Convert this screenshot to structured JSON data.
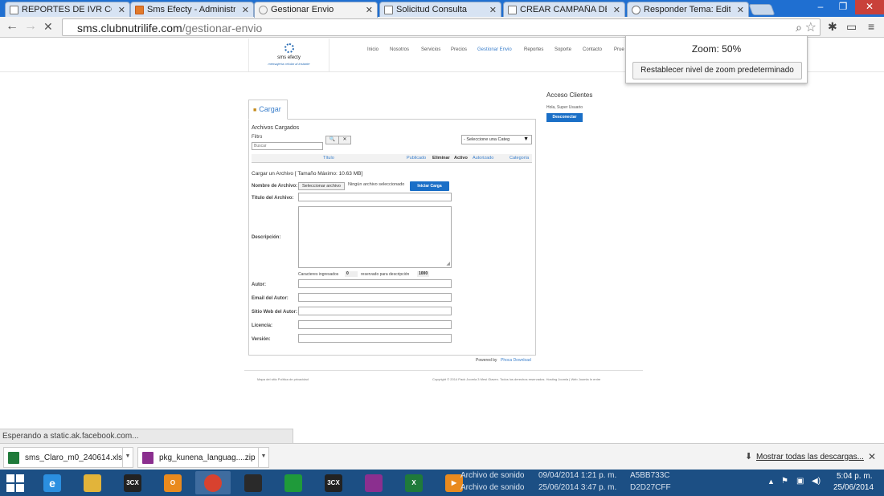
{
  "browser": {
    "tabs": [
      {
        "title": "REPORTES DE IVR CON M..."
      },
      {
        "title": "Sms Efecty - Administraci..."
      },
      {
        "title": "Gestionar Envio"
      },
      {
        "title": "Solicitud Consulta"
      },
      {
        "title": "CREAR CAMPAÑA DE IVR..."
      },
      {
        "title": "Responder Tema: Editar F..."
      }
    ],
    "url_host": "sms.clubnutrilife.com",
    "url_path": "/gestionar-envio",
    "zoom_popup": {
      "title": "Zoom: 50%",
      "reset_label": "Restablecer nivel de zoom predeterminado"
    }
  },
  "site": {
    "logo_name": "sms efecty",
    "logo_tagline": "mensajería celular al instante",
    "nav": [
      "Inicio",
      "Nosotros",
      "Servicios",
      "Precios",
      "Gestionar Envio",
      "Reportes",
      "Soporte",
      "Contacto",
      "Prue"
    ],
    "active_nav": "Gestionar Envio",
    "upload": {
      "tab_label": "Cargar",
      "section_title": "Archivos Cargados",
      "filter_label": "Filtro",
      "filter_placeholder": "Buscar",
      "search_btn": "🔍",
      "clear_btn": "✕",
      "category_select": "- Seleccione una Categ",
      "columns": [
        "Título",
        "Publicado",
        "Eliminar",
        "Activo",
        "Autorizado",
        "Categoría"
      ],
      "upload_title": "Cargar un Archivo [ Tamaño Máximo: 10.63 MB]",
      "file_label": "Nombre de Archivo:",
      "select_file_btn": "Seleccionar archivo",
      "no_file_text": "Ningún archivo seleccionado",
      "start_upload_btn": "Iniciar Carga",
      "title_label": "Título del Archivo:",
      "desc_label": "Descripción:",
      "chars_label": "Caracteres ingresados",
      "chars_value": "0",
      "reserved_label": "reservado para descripción",
      "reserved_value": "1000",
      "author_label": "Autor:",
      "email_label": "Email del Autor:",
      "website_label": "Sitio Web del Autor:",
      "license_label": "Licencia:",
      "version_label": "Versión:",
      "powered_by": "Powered by",
      "powered_link": "Phoca Download"
    },
    "sidebar": {
      "title": "Acceso Clientes",
      "greeting": "Hola, Super Usuario",
      "logout_btn": "Desconectar"
    },
    "footer": {
      "left_links": "Mapa del sitio   Política de privacidad",
      "copyright": "Copyright © 2014 Pack Joomla 3 Mesi Giaven. Todos los derechos reservados. Hosting Joomla | Web Joomla   In entre"
    }
  },
  "status": {
    "text": "Esperando a static.ak.facebook.com..."
  },
  "downloads": {
    "items": [
      {
        "name": "sms_Claro_m0_240614.xls",
        "icon_color": "#1f7a3a"
      },
      {
        "name": "pkg_kunena_languag....zip",
        "icon_color": "#8b2f8f"
      }
    ],
    "show_all": "Mostrar todas las descargas..."
  },
  "taskbar": {
    "bg_files": [
      {
        "name": "Archivo de sonido",
        "date": "09/04/2014 1:21 p. m.",
        "hash": "A5BB733C"
      },
      {
        "name": "Archivo de sonido",
        "date": "25/06/2014 3:47 p. m.",
        "hash": "D2D27CFF"
      }
    ],
    "time": "5:04 p. m.",
    "date": "25/06/2014"
  }
}
